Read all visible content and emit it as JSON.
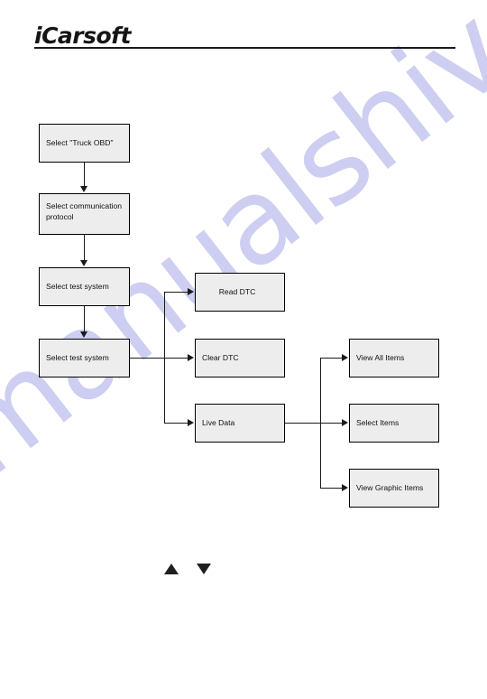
{
  "header": {
    "logo": "iCarsoft"
  },
  "watermark": {
    "text": "manualshive.com"
  },
  "flowchart": {
    "nodes": [
      {
        "id": "select-truck-obd",
        "label": "Select \"Truck OBD\"",
        "line2": ""
      },
      {
        "id": "select-protocol",
        "label": "Select communication",
        "line2": "protocol"
      },
      {
        "id": "select-test-system-1",
        "label": "Select test system",
        "line2": ""
      },
      {
        "id": "select-test-system-2",
        "label": "Select test system",
        "line2": ""
      },
      {
        "id": "read-dtc",
        "label": "Read DTC",
        "line2": ""
      },
      {
        "id": "clear-dtc",
        "label": "Clear DTC",
        "line2": ""
      },
      {
        "id": "live-data",
        "label": "Live Data",
        "line2": ""
      },
      {
        "id": "view-all-items",
        "label": "View All Items",
        "line2": ""
      },
      {
        "id": "select-items",
        "label": "Select Items",
        "line2": ""
      },
      {
        "id": "view-graphic-items",
        "label": "View Graphic Items",
        "line2": ""
      }
    ]
  },
  "navigation": {
    "up_icon": "triangle-up",
    "down_icon": "triangle-down"
  },
  "colors": {
    "node_fill": "#ededed",
    "node_border": "#000000",
    "line": "#1a1a1a",
    "watermark": "#ccccf2",
    "text": "#101010"
  }
}
